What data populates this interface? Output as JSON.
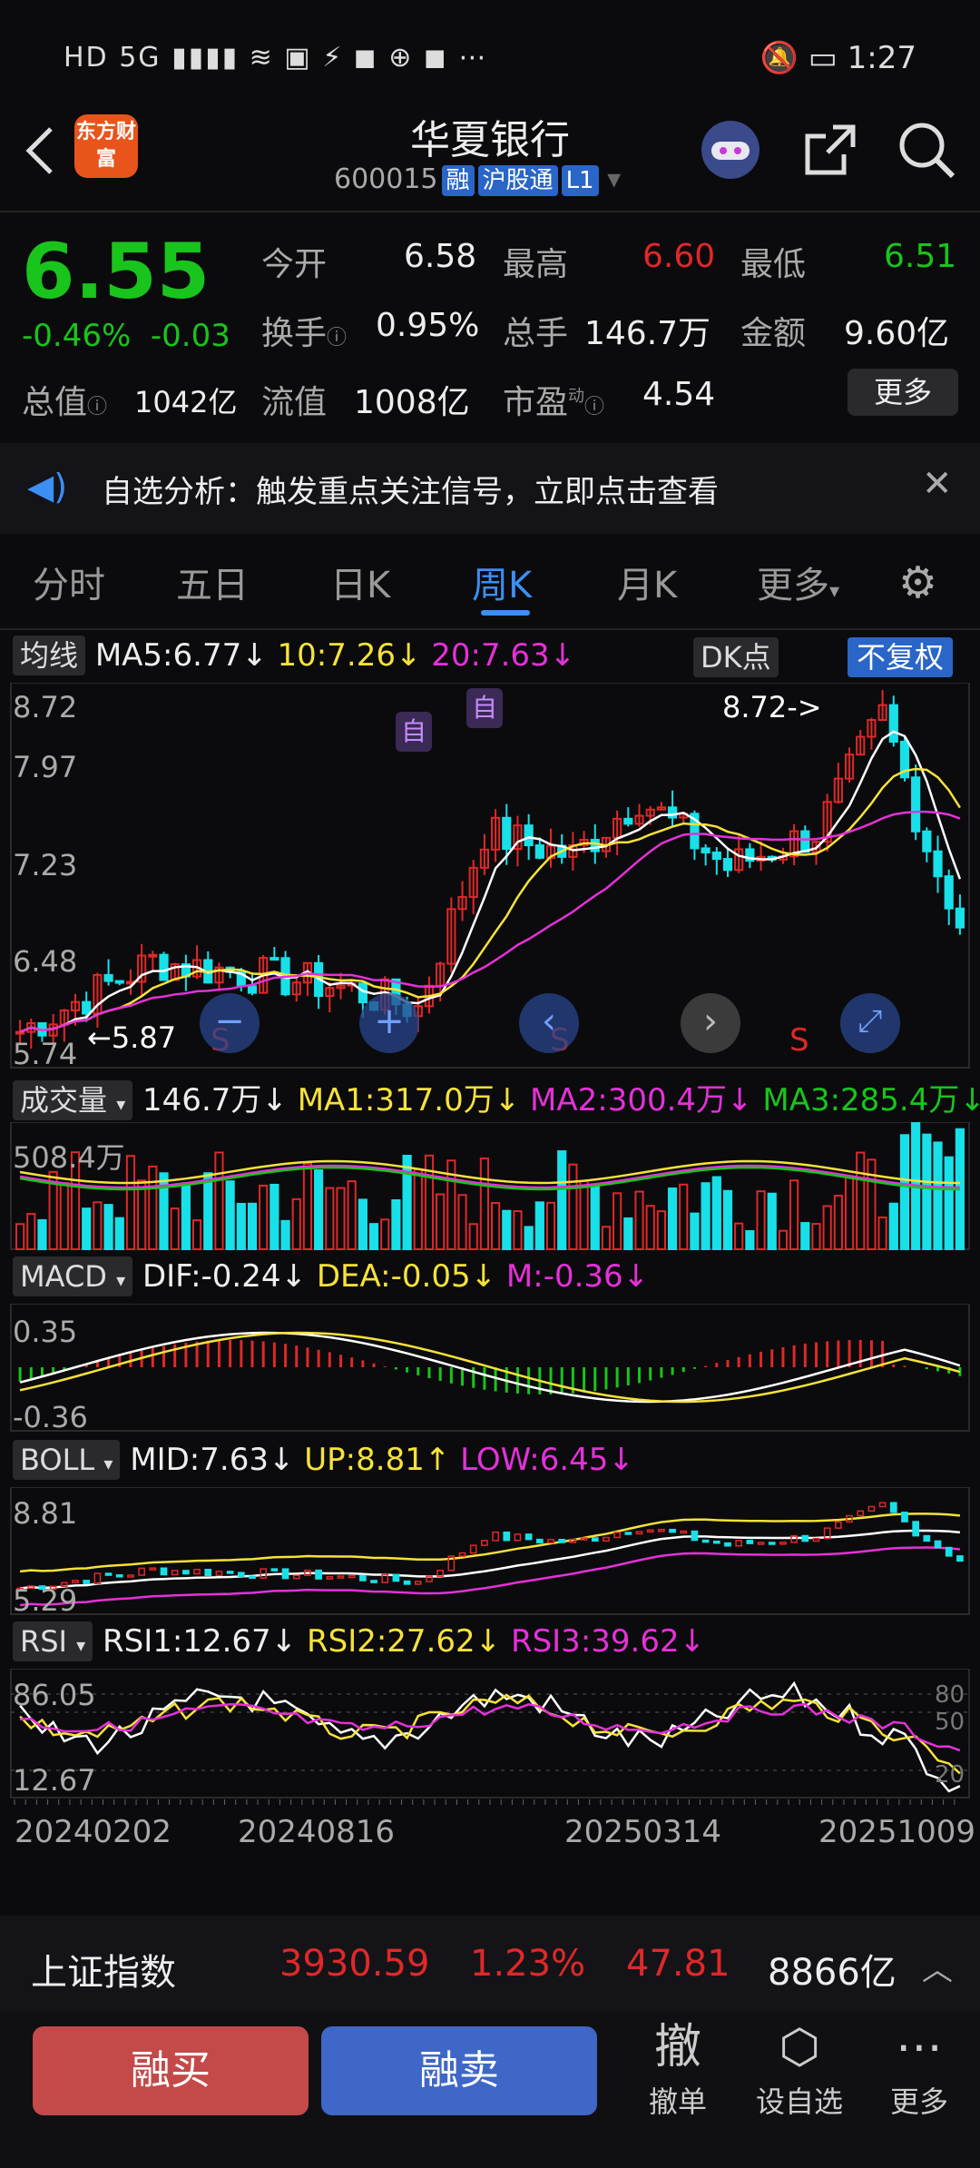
{
  "status_bar": {
    "left": "HD 5G",
    "time": "1:27"
  },
  "header": {
    "logo": "东方财富",
    "name": "华夏银行",
    "code": "600015",
    "tags": [
      "融",
      "沪股通",
      "L1"
    ]
  },
  "quote": {
    "price": "6.55",
    "change_pct": "-0.46%",
    "change": "-0.03",
    "open_label": "今开",
    "open": "6.58",
    "high_label": "最高",
    "high": "6.60",
    "low_label": "最低",
    "low": "6.51",
    "turnover_label": "换手",
    "turnover": "0.95%",
    "volume_label": "总手",
    "volume": "146.7万",
    "amount_label": "金额",
    "amount": "9.60亿",
    "mcap_label": "总值",
    "mcap": "1042亿",
    "float_label": "流值",
    "float": "1008亿",
    "pe_label": "市盈",
    "pe_sup": "动",
    "pe": "4.54",
    "more": "更多"
  },
  "notice": {
    "text": "自选分析：触发重点关注信号，立即点击查看"
  },
  "tabs": [
    "分时",
    "五日",
    "日K",
    "周K",
    "月K",
    "更多"
  ],
  "active_tab": "周K",
  "main_chart": {
    "ma_btn": "均线",
    "ma5": "MA5:6.77",
    "ma10": "10:7.26",
    "ma20": "20:7.63",
    "dk_btn": "DK点",
    "adj_btn": "不复权",
    "y_labels": [
      "8.72",
      "7.97",
      "7.23",
      "6.48",
      "5.74"
    ],
    "max_label": "8.72->",
    "min_label": "5.87",
    "marker": "自",
    "s_marker": "S"
  },
  "volume": {
    "btn": "成交量",
    "value": "146.7万",
    "ma1": "MA1:317.0万",
    "ma2": "MA2:300.4万",
    "ma3": "MA3:285.4万",
    "y_label": "508.4万"
  },
  "macd": {
    "btn": "MACD",
    "dif": "DIF:-0.24",
    "dea": "DEA:-0.05",
    "m": "M:-0.36",
    "y_top": "0.35",
    "y_bottom": "-0.36"
  },
  "boll": {
    "btn": "BOLL",
    "mid": "MID:7.63",
    "up": "UP:8.81",
    "low": "LOW:6.45",
    "y_top": "8.81",
    "y_bottom": "5.29"
  },
  "rsi": {
    "btn": "RSI",
    "rsi1": "RSI1:12.67",
    "rsi2": "RSI2:27.62",
    "rsi3": "RSI3:39.62",
    "y_top": "86.05",
    "y_bottom": "12.67",
    "levels": [
      "80",
      "50",
      "20"
    ]
  },
  "dates": [
    "20240202",
    "20240816",
    "20250314",
    "20251009"
  ],
  "ticker": {
    "name": "上证指数",
    "value": "3930.59",
    "pct": "1.23%",
    "change": "47.81",
    "amount": "8866亿"
  },
  "actions": {
    "buy": "融买",
    "sell": "融卖",
    "cancel_icon": "撤",
    "cancel": "撤单",
    "watch": "设自选",
    "more": "更多"
  },
  "colors": {
    "up": "#e02828",
    "down": "#19c41d",
    "accent": "#3b8ff5",
    "cyan": "#18e0e8",
    "yellow": "#f6e23a",
    "magenta": "#e531d8"
  }
}
